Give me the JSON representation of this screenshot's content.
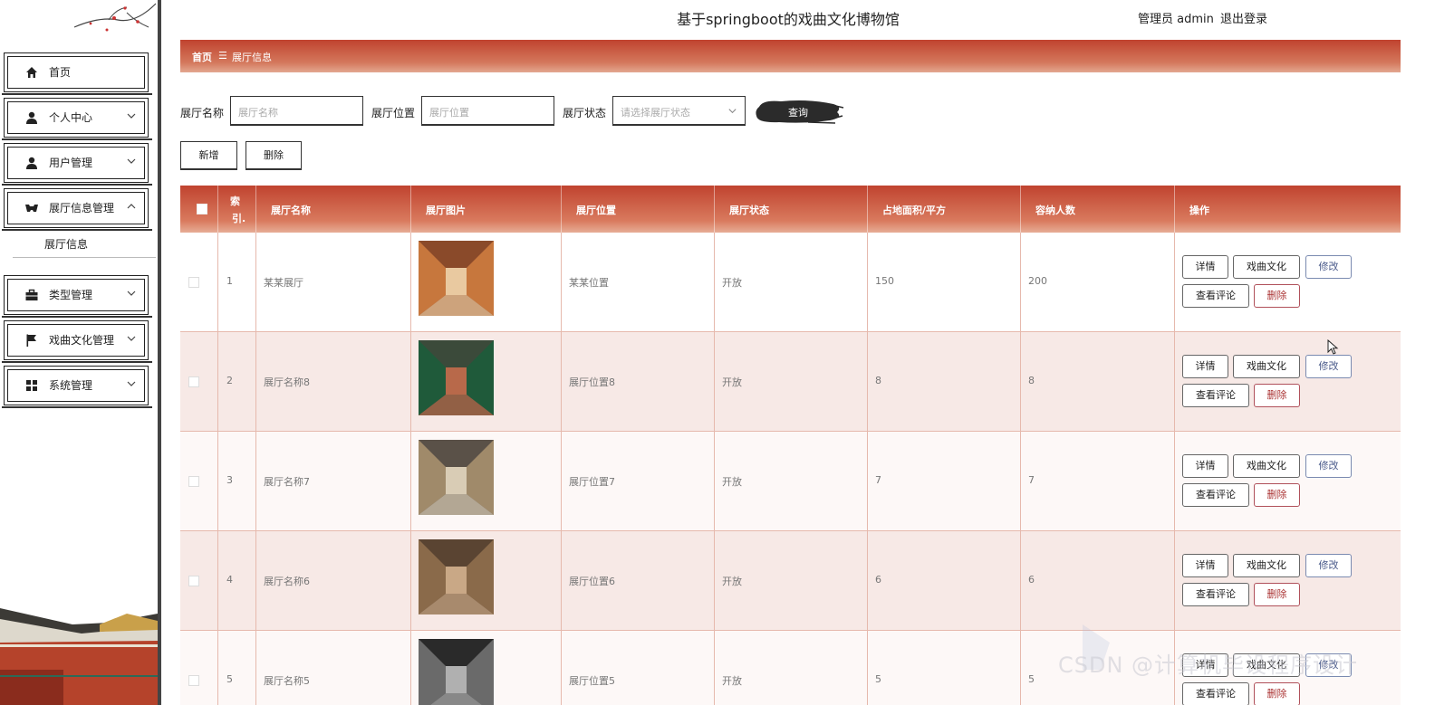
{
  "header": {
    "title": "基于springboot的戏曲文化博物馆",
    "user_label": "管理员 admin",
    "logout_label": "退出登录"
  },
  "sidebar": {
    "items": [
      {
        "label": "首页",
        "icon": "home-icon"
      },
      {
        "label": "个人中心",
        "icon": "user-icon"
      },
      {
        "label": "用户管理",
        "icon": "user-icon"
      },
      {
        "label": "展厅信息管理",
        "icon": "hall-icon"
      },
      {
        "label": "类型管理",
        "icon": "briefcase-icon"
      },
      {
        "label": "戏曲文化管理",
        "icon": "flag-icon"
      },
      {
        "label": "系统管理",
        "icon": "grid-icon"
      }
    ],
    "submenu": {
      "label": "展厅信息"
    }
  },
  "breadcrumb": {
    "home": "首页",
    "separator": "☰",
    "current": "展厅信息"
  },
  "search": {
    "name_label": "展厅名称",
    "name_placeholder": "展厅名称",
    "location_label": "展厅位置",
    "location_placeholder": "展厅位置",
    "status_label": "展厅状态",
    "status_placeholder": "请选择展厅状态",
    "button_label": "查询"
  },
  "actions": {
    "add_label": "新增",
    "delete_label": "删除"
  },
  "table": {
    "columns": [
      "索引",
      "展厅名称",
      "展厅图片",
      "展厅位置",
      "展厅状态",
      "占地面积/平方",
      "容纳人数",
      "操作"
    ],
    "index_header": [
      "索",
      "引."
    ],
    "rows": [
      {
        "index": "1",
        "name": "某某展厅",
        "location": "某某位置",
        "status": "开放",
        "area": "150",
        "capacity": "200"
      },
      {
        "index": "2",
        "name": "展厅名称8",
        "location": "展厅位置8",
        "status": "开放",
        "area": "8",
        "capacity": "8"
      },
      {
        "index": "3",
        "name": "展厅名称7",
        "location": "展厅位置7",
        "status": "开放",
        "area": "7",
        "capacity": "7"
      },
      {
        "index": "4",
        "name": "展厅名称6",
        "location": "展厅位置6",
        "status": "开放",
        "area": "6",
        "capacity": "6"
      },
      {
        "index": "5",
        "name": "展厅名称5",
        "location": "展厅位置5",
        "status": "开放",
        "area": "5",
        "capacity": "5"
      }
    ],
    "op_labels": {
      "detail": "详情",
      "culture": "戏曲文化",
      "edit": "修改",
      "comments": "查看评论",
      "delete": "删除"
    }
  },
  "watermark": "CSDN @计算机毕设程序设计",
  "colors": {
    "accent": "#c0432f",
    "accent_light": "#e3a790",
    "row_alt": "#f7e9e6",
    "edit_blue": "#4a5a8a",
    "delete_red": "#a33"
  }
}
